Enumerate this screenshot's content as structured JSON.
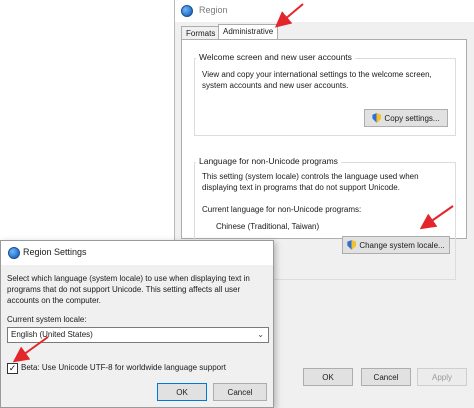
{
  "region_window": {
    "title": "Region",
    "tabs": [
      {
        "label": "Formats"
      },
      {
        "label": "Administrative"
      }
    ],
    "welcome_group": {
      "label": "Welcome screen and new user accounts",
      "description": "View and copy your international settings to the welcome screen, system accounts and new user accounts.",
      "button": "Copy settings..."
    },
    "language_group": {
      "label": "Language for non-Unicode programs",
      "description": "This setting (system locale) controls the language used when displaying text in programs that do not support Unicode.",
      "current_label": "Current language for non-Unicode programs:",
      "current_value": "Chinese (Traditional, Taiwan)",
      "button": "Change system locale..."
    },
    "buttons": {
      "ok": "OK",
      "cancel": "Cancel",
      "apply": "Apply"
    }
  },
  "settings_dialog": {
    "title": "Region Settings",
    "description": "Select which language (system locale) to use when displaying text in programs that do not support Unicode. This setting affects all user accounts on the computer.",
    "locale_label": "Current system locale:",
    "locale_value": "English (United States)",
    "beta_checked": true,
    "beta_label": "Beta: Use Unicode UTF-8 for worldwide language support",
    "buttons": {
      "ok": "OK",
      "cancel": "Cancel"
    }
  },
  "colors": {
    "annotation": "#e3262b",
    "accent": "#0078d7"
  },
  "icons": [
    "globe-icon",
    "shield-icon",
    "chevron-down-icon",
    "checkmark-icon",
    "arrow-annotation"
  ]
}
